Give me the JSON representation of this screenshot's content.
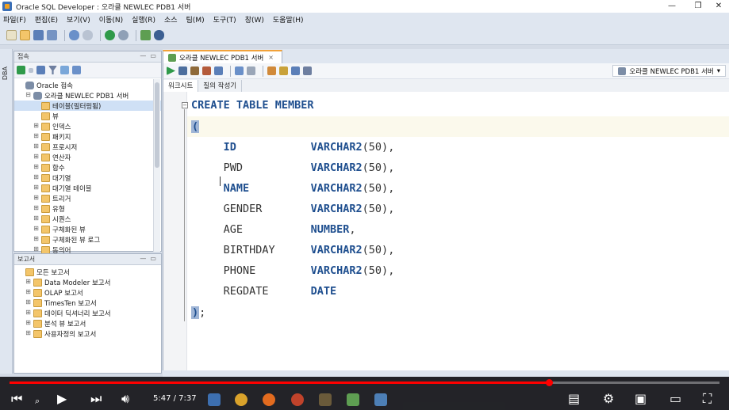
{
  "window": {
    "title": "Oracle SQL Developer : 오라클 NEWLEC PDB1 서버"
  },
  "menu": [
    "파일(F)",
    "편집(E)",
    "보기(V)",
    "이동(N)",
    "실행(R)",
    "소스",
    "팀(M)",
    "도구(T)",
    "창(W)",
    "도움말(H)"
  ],
  "side_strip_label": "DBA",
  "connections_panel": {
    "title": "접속",
    "tree": [
      {
        "label": "Oracle 접속",
        "level": 0,
        "icon": "db",
        "exp": ""
      },
      {
        "label": "오라클 NEWLEC PDB1 서버",
        "level": 1,
        "icon": "db",
        "exp": "−"
      },
      {
        "label": "테이블(필터링됨)",
        "level": 2,
        "icon": "folder",
        "exp": "",
        "selected": true
      },
      {
        "label": "뷰",
        "level": 2,
        "icon": "folder",
        "exp": ""
      },
      {
        "label": "인덱스",
        "level": 2,
        "icon": "folder",
        "exp": "+"
      },
      {
        "label": "패키지",
        "level": 2,
        "icon": "folder",
        "exp": "+"
      },
      {
        "label": "프로시저",
        "level": 2,
        "icon": "folder",
        "exp": "+"
      },
      {
        "label": "연산자",
        "level": 2,
        "icon": "folder",
        "exp": "+"
      },
      {
        "label": "함수",
        "level": 2,
        "icon": "folder",
        "exp": "+"
      },
      {
        "label": "대기열",
        "level": 2,
        "icon": "folder",
        "exp": "+"
      },
      {
        "label": "대기열 테이블",
        "level": 2,
        "icon": "folder",
        "exp": "+"
      },
      {
        "label": "트리거",
        "level": 2,
        "icon": "folder",
        "exp": "+"
      },
      {
        "label": "유형",
        "level": 2,
        "icon": "folder",
        "exp": "+"
      },
      {
        "label": "시퀀스",
        "level": 2,
        "icon": "folder",
        "exp": "+"
      },
      {
        "label": "구체화된 뷰",
        "level": 2,
        "icon": "folder",
        "exp": "+"
      },
      {
        "label": "구체화된 뷰 로그",
        "level": 2,
        "icon": "folder",
        "exp": "+"
      },
      {
        "label": "동의어",
        "level": 2,
        "icon": "folder",
        "exp": "+"
      }
    ]
  },
  "reports_panel": {
    "title": "보고서",
    "tree": [
      {
        "label": "모든 보고서",
        "level": 0,
        "icon": "folder",
        "exp": ""
      },
      {
        "label": "Data Modeler 보고서",
        "level": 1,
        "icon": "folder",
        "exp": "+"
      },
      {
        "label": "OLAP 보고서",
        "level": 1,
        "icon": "folder",
        "exp": "+"
      },
      {
        "label": "TimesTen 보고서",
        "level": 1,
        "icon": "folder",
        "exp": "+"
      },
      {
        "label": "데이터 딕셔너리 보고서",
        "level": 1,
        "icon": "folder",
        "exp": "+"
      },
      {
        "label": "분석 뷰 보고서",
        "level": 1,
        "icon": "folder",
        "exp": "+"
      },
      {
        "label": "사용자정의 보고서",
        "level": 1,
        "icon": "folder",
        "exp": "+"
      }
    ]
  },
  "editor": {
    "tab_label": "오라클 NEWLEC PDB1 서버",
    "connection_select": "오라클 NEWLEC PDB1 서버",
    "subtabs": [
      "워크시트",
      "질의 작성기"
    ],
    "code": {
      "header": [
        "CREATE",
        "TABLE",
        "MEMBER"
      ],
      "open_paren": "(",
      "columns": [
        {
          "name": "ID",
          "name_kw": true,
          "type": "VARCHAR2",
          "size": "(50)",
          "sep": ","
        },
        {
          "name": "PWD",
          "name_kw": false,
          "type": "VARCHAR2",
          "size": "(50)",
          "sep": ","
        },
        {
          "name": "NAME",
          "name_kw": true,
          "type": "VARCHAR2",
          "size": "(50)",
          "sep": ","
        },
        {
          "name": "GENDER",
          "name_kw": false,
          "type": "VARCHAR2",
          "size": "(50)",
          "sep": ","
        },
        {
          "name": "AGE",
          "name_kw": false,
          "type": "NUMBER",
          "size": "",
          "sep": ","
        },
        {
          "name": "BIRTHDAY",
          "name_kw": false,
          "type": "VARCHAR2",
          "size": "(50)",
          "sep": ","
        },
        {
          "name": "PHONE",
          "name_kw": false,
          "type": "VARCHAR2",
          "size": "(50)",
          "sep": ","
        },
        {
          "name": "REGDATE",
          "name_kw": false,
          "type": "DATE",
          "size": "",
          "sep": ""
        }
      ],
      "close": ")",
      "terminator": ";"
    }
  },
  "video": {
    "time": "5:47 / 7:37",
    "progress": 0.76
  },
  "colors": {
    "keyword": "#1f4f8f",
    "progress": "#ff0000",
    "tab_accent": "#f2a23a"
  }
}
